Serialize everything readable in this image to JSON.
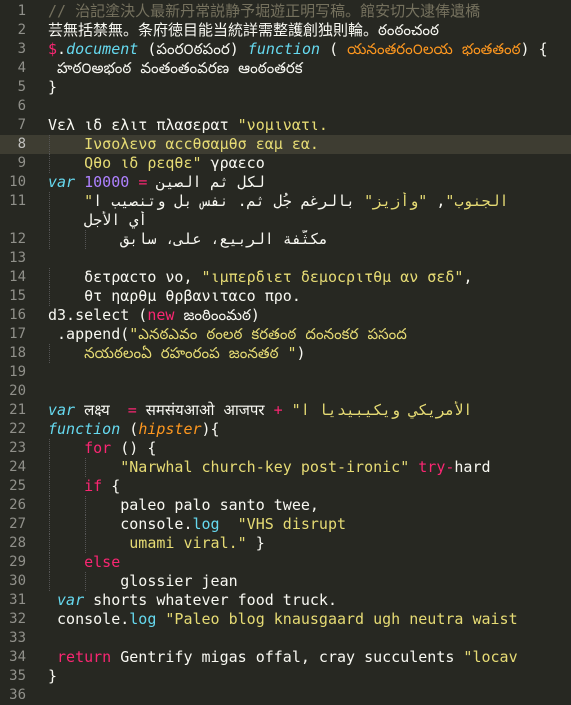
{
  "lines": [
    {
      "n": "1",
      "tokens": [
        {
          "c": "t-comment",
          "t": "// 治記塗決人最新丹常説静予堀遊正明写稿。館安切大逮俸遺橋"
        }
      ]
    },
    {
      "n": "2",
      "tokens": [
        {
          "c": "t-plain",
          "t": "芸無括禁無。条府徳目能当統詳需整護創独則輪。ఠంఠంచంఠ"
        }
      ]
    },
    {
      "n": "3",
      "tokens": [
        {
          "c": "t-keyword",
          "t": "$"
        },
        {
          "c": "t-plain",
          "t": "."
        },
        {
          "c": "t-storage",
          "t": "document"
        },
        {
          "c": "t-plain",
          "t": " (పంర౦ఠపంర) "
        },
        {
          "c": "t-storage",
          "t": "function"
        },
        {
          "c": "t-plain",
          "t": " ( "
        },
        {
          "c": "t-param-plain",
          "t": "యనంతరం౦లయ భంతతంఠ"
        },
        {
          "c": "t-plain",
          "t": ") {"
        }
      ]
    },
    {
      "n": "4",
      "tokens": [
        {
          "c": "t-plain",
          "t": " హఠ౦అభంఠ వంతంతంవరణ ఆంఠంతరక"
        }
      ]
    },
    {
      "n": "5",
      "tokens": [
        {
          "c": "t-plain",
          "t": "}"
        }
      ]
    },
    {
      "n": "6",
      "tokens": []
    },
    {
      "n": "7",
      "tokens": [
        {
          "c": "t-plain",
          "t": "Vελ ιδ ελιτ πλασερατ "
        },
        {
          "c": "t-string",
          "t": "\"νομινατι."
        }
      ]
    },
    {
      "n": "8",
      "current": true,
      "guide": true,
      "tokens": [
        {
          "c": "t-string",
          "t": "    Ινσολενσ αccθσαμθσ εαμ εα."
        }
      ]
    },
    {
      "n": "9",
      "guide": true,
      "tokens": [
        {
          "c": "t-string",
          "t": "    Qθο ιδ ρεqθε\""
        },
        {
          "c": "t-plain",
          "t": " γραεcο"
        }
      ]
    },
    {
      "n": "10",
      "tokens": [
        {
          "c": "t-storage",
          "t": "var"
        },
        {
          "c": "t-plain",
          "t": " لكل ثم الصين "
        },
        {
          "c": "t-keyword",
          "t": "="
        },
        {
          "c": "t-plain",
          "t": " "
        },
        {
          "c": "t-number",
          "t": "10000"
        }
      ]
    },
    {
      "n": "11",
      "guide": true,
      "tokens": [
        {
          "c": "t-string",
          "t": "    \"الجنوب\""
        },
        {
          "c": "t-plain",
          "t": ", "
        },
        {
          "c": "t-string",
          "t": "\"وأزيز\""
        },
        {
          "c": "t-plain",
          "t": " بالرغم جُل ثم. نفس بل وتنصيب ا"
        }
      ]
    },
    {
      "n": "",
      "guide": true,
      "tokens": [
        {
          "c": "t-plain",
          "t": "    أي الأجل"
        }
      ]
    },
    {
      "n": "12",
      "guide": true,
      "guide2": true,
      "tokens": [
        {
          "c": "t-plain",
          "t": "        مكثّفة الربيع، على، سابق"
        }
      ]
    },
    {
      "n": "13",
      "tokens": []
    },
    {
      "n": "14",
      "guide": true,
      "tokens": [
        {
          "c": "t-plain",
          "t": "    δετραcτο νο, "
        },
        {
          "c": "t-string",
          "t": "\"ιμπερδιετ δεμοcριτθμ αν σεδ\""
        },
        {
          "c": "t-plain",
          "t": ","
        }
      ]
    },
    {
      "n": "15",
      "guide": true,
      "tokens": [
        {
          "c": "t-plain",
          "t": "    θτ ηαρθμ θρβανιταcο προ."
        }
      ]
    },
    {
      "n": "16",
      "tokens": [
        {
          "c": "t-plain",
          "t": "d3.select ("
        },
        {
          "c": "t-keyword",
          "t": "new"
        },
        {
          "c": "t-plain",
          "t": " జంఠింంమఠ)"
        }
      ]
    },
    {
      "n": "17",
      "tokens": [
        {
          "c": "t-plain",
          "t": " .append("
        },
        {
          "c": "t-string",
          "t": "\"ఎనఠఎవం ఠంలఠ కరతంఠ దంనంకర పసంద"
        }
      ]
    },
    {
      "n": "18",
      "guide": true,
      "tokens": [
        {
          "c": "t-string",
          "t": "    నయఠలంఏ రహంరంప జంనతఠ "
        },
        {
          "c": "t-string",
          "t": "\""
        },
        {
          "c": "t-plain",
          "t": ")"
        }
      ]
    },
    {
      "n": "19",
      "tokens": []
    },
    {
      "n": "20",
      "tokens": []
    },
    {
      "n": "21",
      "tokens": [
        {
          "c": "t-storage",
          "t": "var"
        },
        {
          "c": "t-plain",
          "t": " लक्ष्य  "
        },
        {
          "c": "t-keyword",
          "t": "="
        },
        {
          "c": "t-plain",
          "t": " समसंयआओ आजपर "
        },
        {
          "c": "t-keyword",
          "t": "+"
        },
        {
          "c": "t-plain",
          "t": " "
        },
        {
          "c": "t-string",
          "t": "\"الأمريكي ويكيبيديا ا"
        }
      ]
    },
    {
      "n": "22",
      "tokens": [
        {
          "c": "t-storage",
          "t": "function"
        },
        {
          "c": "t-plain",
          "t": " ("
        },
        {
          "c": "t-param",
          "t": "hipster"
        },
        {
          "c": "t-plain",
          "t": "){"
        }
      ]
    },
    {
      "n": "23",
      "guide": true,
      "tokens": [
        {
          "c": "t-keyword",
          "t": "    for"
        },
        {
          "c": "t-plain",
          "t": " () {"
        }
      ]
    },
    {
      "n": "24",
      "guide": true,
      "guide2": true,
      "tokens": [
        {
          "c": "t-string",
          "t": "        \"Narwhal church-key post-ironic\""
        },
        {
          "c": "t-plain",
          "t": " "
        },
        {
          "c": "t-keyword",
          "t": "try-"
        },
        {
          "c": "t-plain",
          "t": "hard"
        }
      ]
    },
    {
      "n": "25",
      "guide": true,
      "tokens": [
        {
          "c": "t-keyword",
          "t": "    if"
        },
        {
          "c": "t-plain",
          "t": " {"
        }
      ]
    },
    {
      "n": "26",
      "guide": true,
      "guide2": true,
      "tokens": [
        {
          "c": "t-plain",
          "t": "        paleo palo santo twee,"
        }
      ]
    },
    {
      "n": "27",
      "guide": true,
      "guide2": true,
      "tokens": [
        {
          "c": "t-plain",
          "t": "        console."
        },
        {
          "c": "t-support",
          "t": "log"
        },
        {
          "c": "t-plain",
          "t": "  "
        },
        {
          "c": "t-string",
          "t": "\"VHS disrupt"
        }
      ]
    },
    {
      "n": "28",
      "guide": true,
      "guide2": true,
      "tokens": [
        {
          "c": "t-string",
          "t": "         umami viral.\""
        },
        {
          "c": "t-plain",
          "t": " }"
        }
      ]
    },
    {
      "n": "29",
      "guide": true,
      "tokens": [
        {
          "c": "t-keyword",
          "t": "    else"
        }
      ]
    },
    {
      "n": "30",
      "guide": true,
      "guide2": true,
      "tokens": [
        {
          "c": "t-plain",
          "t": "        glossier jean"
        }
      ]
    },
    {
      "n": "31",
      "tokens": [
        {
          "c": "t-storage",
          "t": " var"
        },
        {
          "c": "t-plain",
          "t": " shorts whatever food truck."
        }
      ]
    },
    {
      "n": "32",
      "tokens": [
        {
          "c": "t-plain",
          "t": " console."
        },
        {
          "c": "t-support",
          "t": "log"
        },
        {
          "c": "t-plain",
          "t": " "
        },
        {
          "c": "t-string",
          "t": "\"Paleo blog knausgaard ugh neutra waist"
        }
      ]
    },
    {
      "n": "33",
      "tokens": []
    },
    {
      "n": "34",
      "tokens": [
        {
          "c": "t-keyword",
          "t": " return"
        },
        {
          "c": "t-plain",
          "t": " Gentrify migas offal, cray succulents "
        },
        {
          "c": "t-string",
          "t": "\"locav"
        }
      ]
    },
    {
      "n": "35",
      "tokens": [
        {
          "c": "t-plain",
          "t": "}"
        }
      ]
    },
    {
      "n": "36",
      "tokens": []
    }
  ]
}
